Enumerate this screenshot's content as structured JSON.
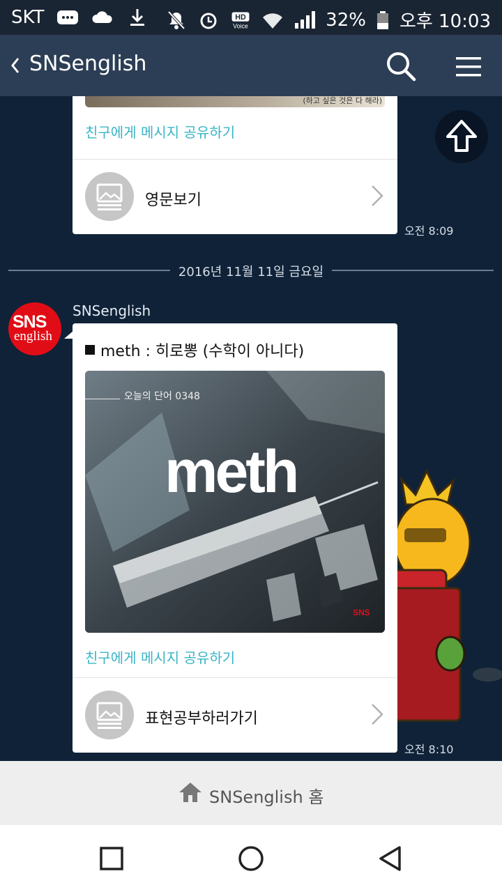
{
  "status_bar": {
    "carrier": "SKT",
    "battery": "32%",
    "time": "오후 10:03"
  },
  "app_bar": {
    "title": "SNSenglish"
  },
  "messages": [
    {
      "share_text": "친구에게 메시지 공유하기",
      "link_label": "영문보기",
      "time": "오전 8:09",
      "image_caption": "(하고 싶은 것은 다 해라)"
    },
    {
      "sender": "SNSenglish",
      "title": "meth : 히로뽕 (수학이 아니다)",
      "image_word_label": "오늘의 단어 0348",
      "image_word": "meth",
      "share_text": "친구에게 메시지 공유하기",
      "link_label": "표현공부하러가기",
      "time": "오전 8:10"
    }
  ],
  "date_separator": "2016년 11월 11일 금요일",
  "avatar": {
    "line1": "SNS",
    "line2": "english"
  },
  "home_bar": {
    "label": "SNSenglish 홈"
  },
  "colors": {
    "chat_bg": "#0f2238",
    "app_bar": "#2c3e55",
    "status_bar": "#1a2533",
    "share_link": "#3ab5c6",
    "avatar": "#e10d16"
  }
}
